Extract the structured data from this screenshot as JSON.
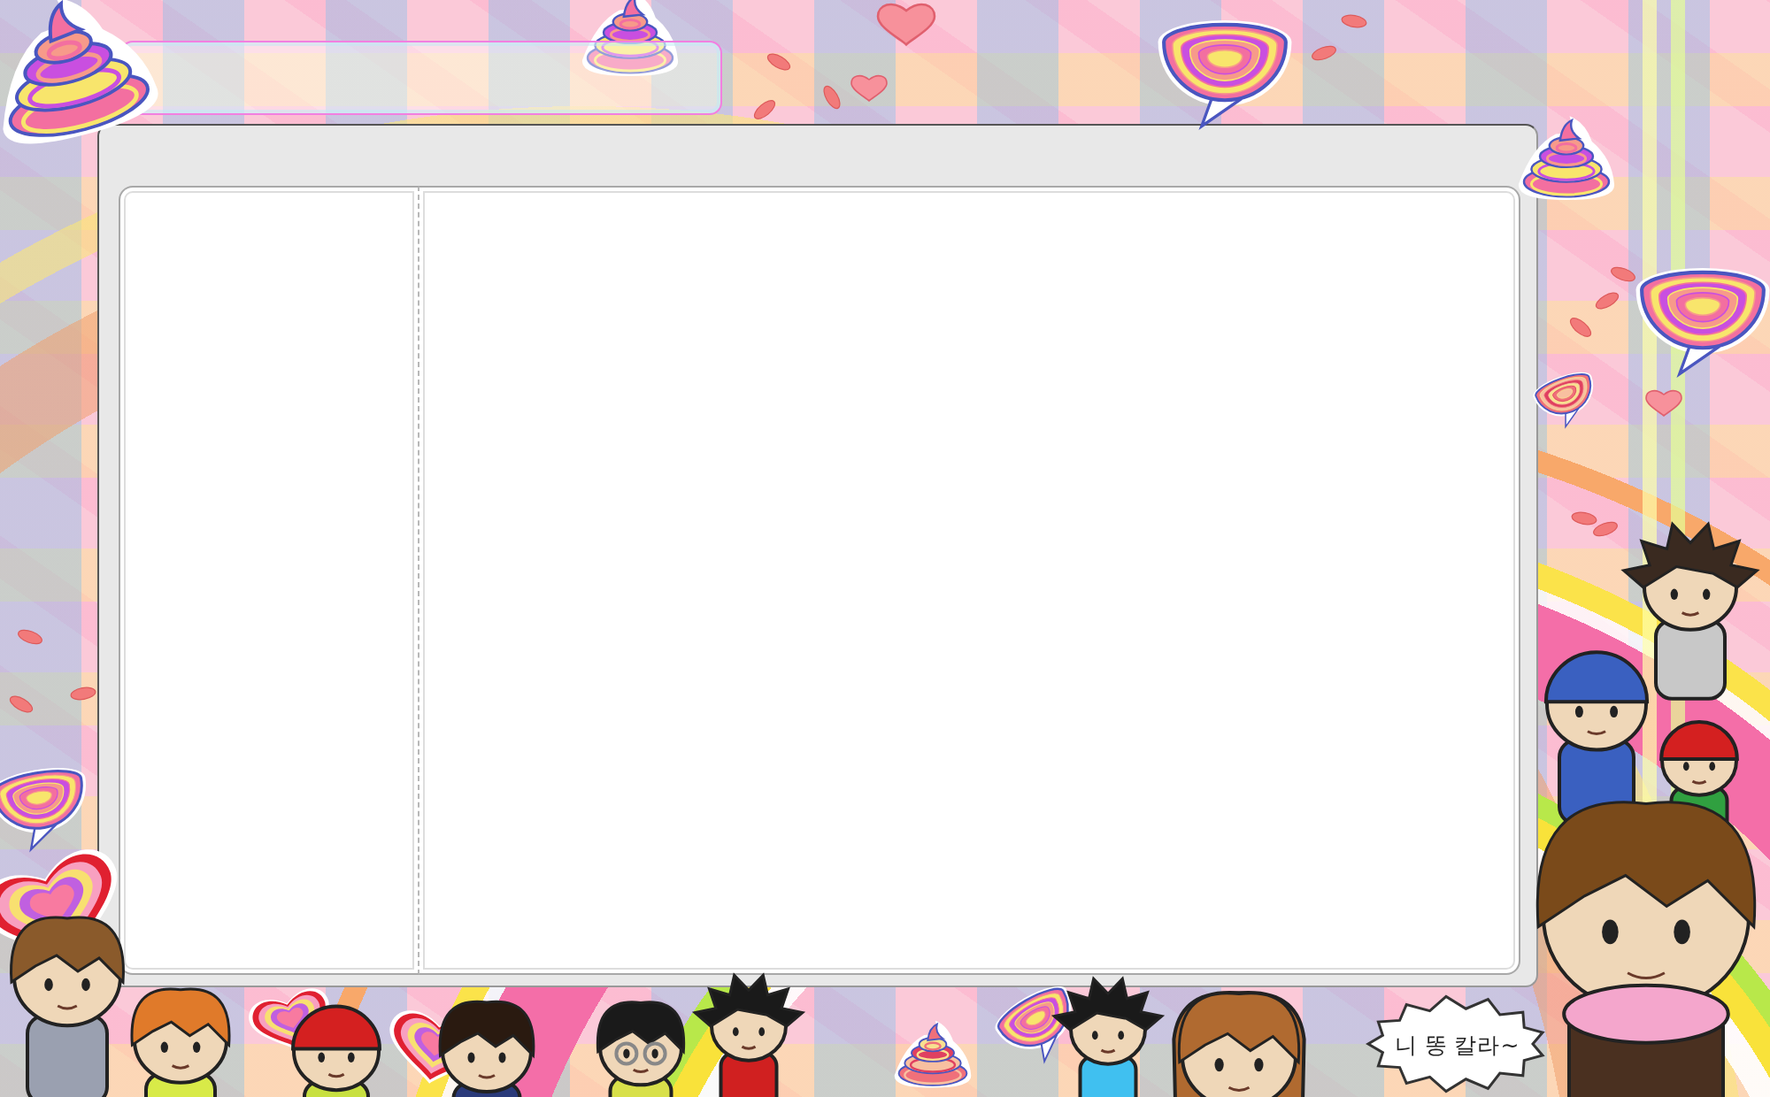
{
  "speech_bubble": {
    "text": "니 똥 칼라~"
  }
}
